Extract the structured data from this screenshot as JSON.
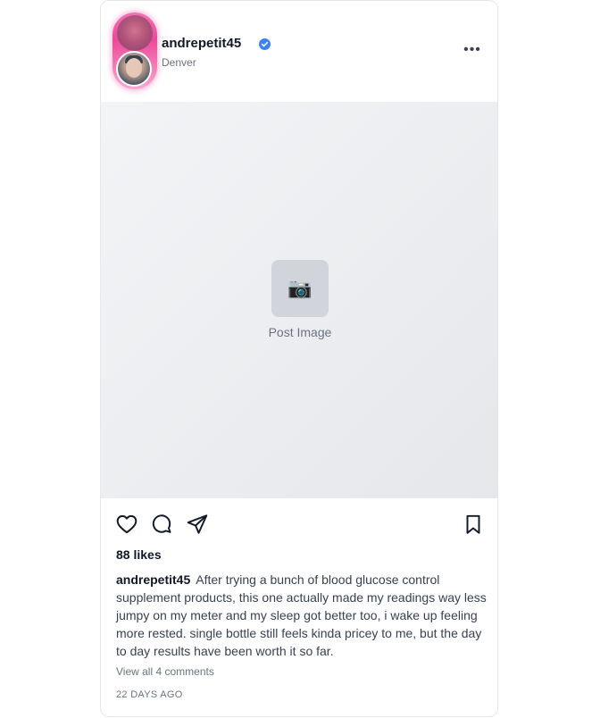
{
  "post": {
    "username": "andrepetit45",
    "location": "Denver",
    "media_label": "Post Image",
    "media_icon": "📷",
    "likes": "88 likes",
    "caption_user": "andrepetit45",
    "caption_text": "After trying a bunch of blood glucose control supplement products, this one actually made my readings way less jumpy on my meter and my sleep got better too, i wake up feeling more rested. single bottle still feels kinda pricey to me, but the day to day results have been worth it so far.",
    "comments_link": "View all 4 comments",
    "timestamp": "22 DAYS AGO",
    "more_icon": "•••"
  },
  "icons": {
    "verified": "verified-badge-icon",
    "more": "more-options-icon",
    "like": "heart-icon",
    "comment": "comment-bubble-icon",
    "share": "paper-plane-icon",
    "save": "bookmark-icon",
    "media": "camera-icon"
  },
  "colors": {
    "verified_blue": "#3b82f6",
    "story_ring": "#ec4899",
    "text_primary": "#111827",
    "text_secondary": "#6b7280"
  }
}
